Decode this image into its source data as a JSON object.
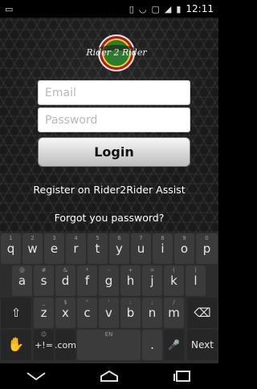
{
  "status_bar": {
    "time": "12:11"
  },
  "logo": {
    "text": "Rider 2 Rider"
  },
  "form": {
    "email_placeholder": "Email",
    "password_placeholder": "Password",
    "login_label": "Login",
    "register_text": "Register on Rider2Rider Assist",
    "forgot_text": "Forgot you password?"
  },
  "keyboard": {
    "row1": [
      {
        "label": "q",
        "hint": "1"
      },
      {
        "label": "w",
        "hint": "2"
      },
      {
        "label": "e",
        "hint": "3"
      },
      {
        "label": "r",
        "hint": "4"
      },
      {
        "label": "t",
        "hint": "5"
      },
      {
        "label": "y",
        "hint": "6"
      },
      {
        "label": "u",
        "hint": "7"
      },
      {
        "label": "i",
        "hint": "8"
      },
      {
        "label": "o",
        "hint": "9"
      },
      {
        "label": "p",
        "hint": "0"
      }
    ],
    "row2": [
      {
        "label": "a",
        "hint": "@"
      },
      {
        "label": "s",
        "hint": "#"
      },
      {
        "label": "d",
        "hint": "&"
      },
      {
        "label": "f",
        "hint": "*"
      },
      {
        "label": "g",
        "hint": "-"
      },
      {
        "label": "h",
        "hint": "+"
      },
      {
        "label": "j",
        "hint": "="
      },
      {
        "label": "k",
        "hint": "("
      },
      {
        "label": "l",
        "hint": ")"
      }
    ],
    "row3": [
      {
        "label": "z",
        "hint": "_"
      },
      {
        "label": "x",
        "hint": "$"
      },
      {
        "label": "c",
        "hint": "\""
      },
      {
        "label": "v",
        "hint": "'"
      },
      {
        "label": "b",
        "hint": ":"
      },
      {
        "label": "n",
        "hint": ";"
      },
      {
        "label": "m",
        "hint": "/"
      }
    ],
    "shift_label": "⇧",
    "backspace_label": "⌫",
    "symbols_label": "+!=",
    "symbols_hint": "☺",
    "com_label": ".com",
    "space_hint": "EN",
    "period_label": ".",
    "mic_label": "🎤",
    "next_label": "Next",
    "swipe_label": "✋"
  },
  "colors": {
    "keyboard_bg": "#2d2d2d",
    "key_bg": "#3b3b3b",
    "login_gradient_top": "#f7f7f7",
    "login_gradient_bottom": "#bdbdbd"
  },
  "icons": {
    "status_left": "notification-icon",
    "status_right": [
      "vibrate-icon",
      "wifi-icon",
      "no-sim-icon",
      "signal-icon",
      "battery-icon"
    ],
    "nav": [
      "back-icon",
      "home-icon",
      "recents-icon"
    ]
  }
}
